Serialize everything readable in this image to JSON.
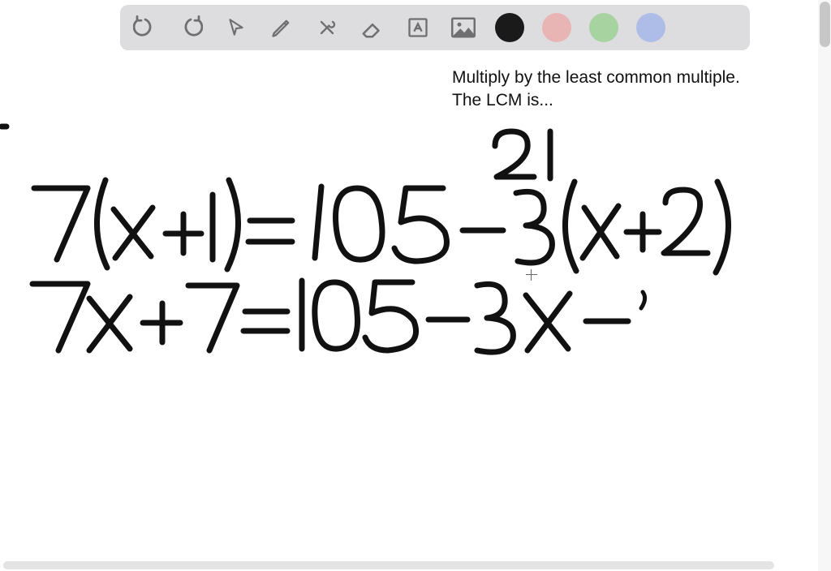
{
  "toolbar": {
    "icons": {
      "undo": "undo-icon",
      "redo": "redo-icon",
      "pointer": "pointer-icon",
      "pencil": "pencil-icon",
      "tools": "tools-icon",
      "eraser": "eraser-icon",
      "text": "text-icon",
      "image": "image-icon"
    },
    "colors": {
      "black": "#1a1a1a",
      "red": "#e9b4b4",
      "green": "#a7d3a0",
      "blue": "#aebde8"
    }
  },
  "caption": {
    "line1": "Multiply by the least common multiple.",
    "line2": "The LCM is..."
  },
  "handwriting": {
    "annotation_top": "21",
    "line1": "7(x+1) = 105 - 3(x+2)",
    "line2": "7x + 7 = 105 - 3x -"
  },
  "stroke": {
    "color": "#111111",
    "width": 7
  }
}
